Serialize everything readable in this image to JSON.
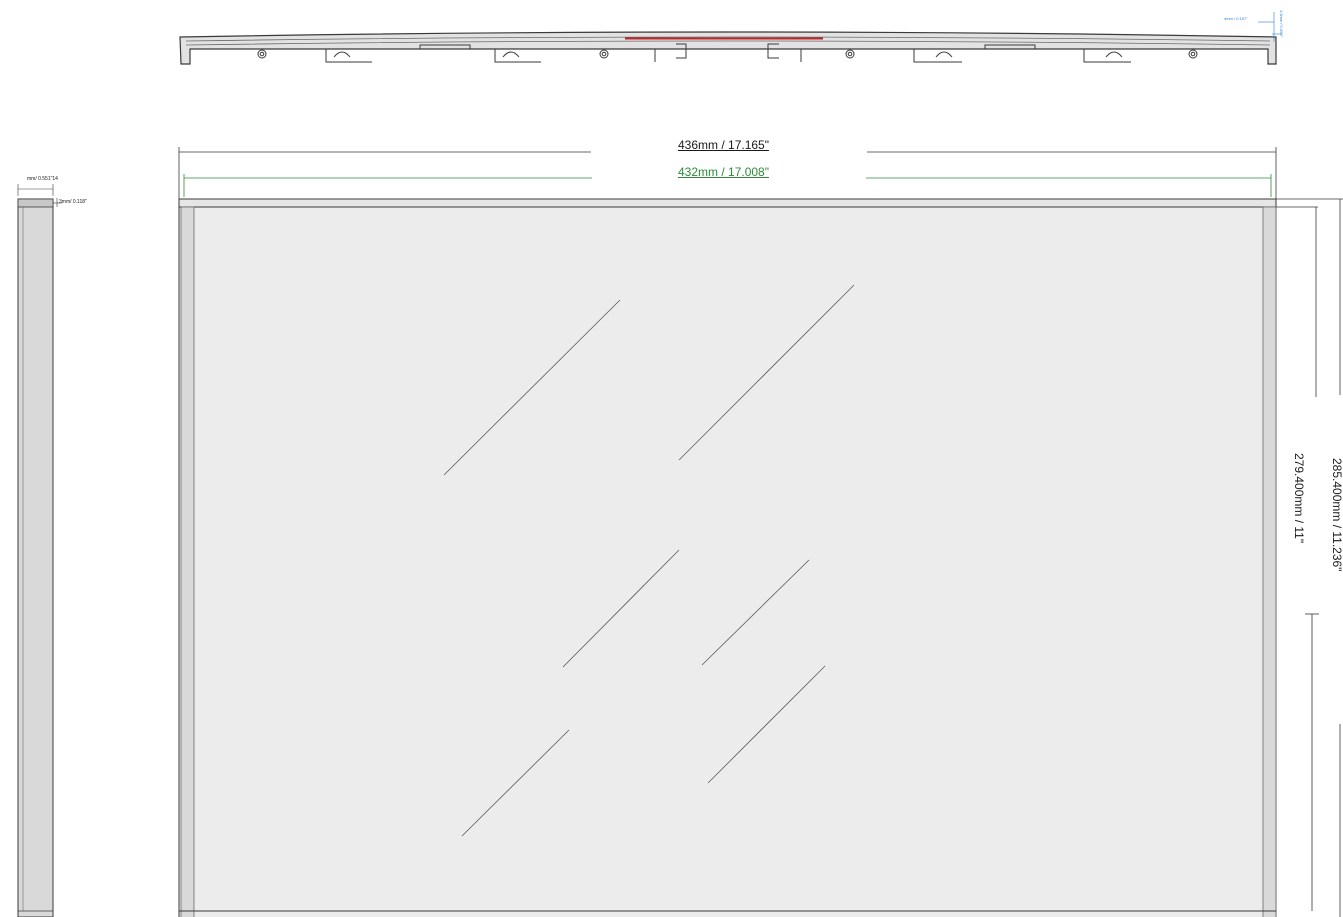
{
  "dimensions": {
    "outer_width": "436mm / 17.165\"",
    "inner_width": "432mm / 17.008\"",
    "outer_height": "285.400mm / 11.236\"",
    "inner_height": "279.400mm / 11\"",
    "side_depth": "mm/ 0.551\"14",
    "side_wall": "3mm/ 0.118\"",
    "top_depth": "4mm / 0.157\"",
    "top_lip": "1.5mm / 0.059\""
  },
  "colors": {
    "outline": "#3a3a3a",
    "panel_fill": "#ececec",
    "frame_fill": "#d9d9d9",
    "green_dimension": "#2e8b3a",
    "blue_dimension": "#2b7fd0",
    "red_highlight": "#c0242b"
  }
}
